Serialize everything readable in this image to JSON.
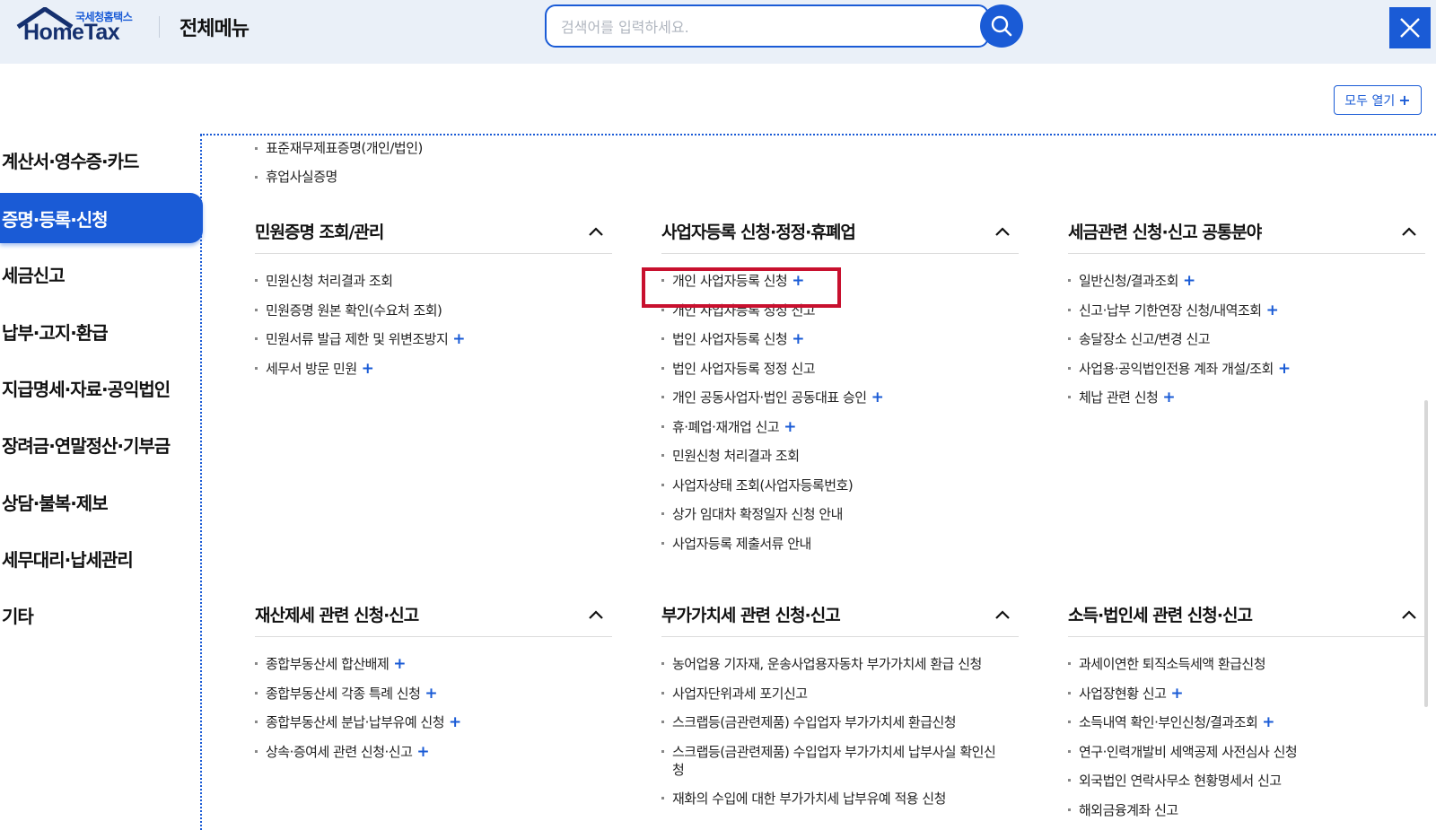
{
  "header": {
    "logo_sub": "국세청홈택스",
    "logo_main": "HomeTax",
    "title": "전체메뉴",
    "search_placeholder": "검색어를 입력하세요.",
    "search_value": ""
  },
  "open_all_label": "모두 열기",
  "open_all_plus": "+",
  "sidebar": {
    "items": [
      {
        "label": "계산서·영수증·카드"
      },
      {
        "label": "증명·등록·신청"
      },
      {
        "label": "세금신고"
      },
      {
        "label": "납부·고지·환급"
      },
      {
        "label": "지급명세·자료·공익법인"
      },
      {
        "label": "장려금·연말정산·기부금"
      },
      {
        "label": "상담·불복·제보"
      },
      {
        "label": "세무대리·납세관리"
      },
      {
        "label": "기타"
      }
    ]
  },
  "stray_items": [
    "표준재무제표증명(개인/법인)",
    "휴업사실증명"
  ],
  "sections": [
    {
      "title": "민원증명 조회/관리",
      "items": [
        {
          "label": "민원신청 처리결과 조회",
          "plus": ""
        },
        {
          "label": "민원증명 원본 확인(수요처 조회)",
          "plus": ""
        },
        {
          "label": "민원서류 발급 제한 및 위변조방지",
          "plus": "+"
        },
        {
          "label": "세무서 방문 민원",
          "plus": "+"
        }
      ]
    },
    {
      "title": "사업자등록 신청·정정·휴폐업",
      "items": [
        {
          "label": "개인 사업자등록 신청",
          "plus": "+"
        },
        {
          "label": "개인 사업자등록 정정 신고",
          "plus": ""
        },
        {
          "label": "법인 사업자등록 신청",
          "plus": "+"
        },
        {
          "label": "법인 사업자등록 정정 신고",
          "plus": ""
        },
        {
          "label": "개인 공동사업자·법인 공동대표 승인",
          "plus": "+"
        },
        {
          "label": "휴·폐업·재개업 신고",
          "plus": "+"
        },
        {
          "label": "민원신청 처리결과 조회",
          "plus": ""
        },
        {
          "label": "사업자상태 조회(사업자등록번호)",
          "plus": ""
        },
        {
          "label": "상가 임대차 확정일자 신청 안내",
          "plus": ""
        },
        {
          "label": "사업자등록 제출서류 안내",
          "plus": ""
        }
      ]
    },
    {
      "title": "세금관련 신청·신고 공통분야",
      "items": [
        {
          "label": "일반신청/결과조회",
          "plus": "+"
        },
        {
          "label": "신고·납부 기한연장 신청/내역조회",
          "plus": "+"
        },
        {
          "label": "송달장소 신고/변경 신고",
          "plus": ""
        },
        {
          "label": "사업용·공익법인전용 계좌 개설/조회",
          "plus": "+"
        },
        {
          "label": "체납 관련 신청",
          "plus": "+"
        }
      ]
    },
    {
      "title": "재산제세 관련 신청·신고",
      "items": [
        {
          "label": "종합부동산세 합산배제",
          "plus": "+"
        },
        {
          "label": "종합부동산세 각종 특례 신청",
          "plus": "+"
        },
        {
          "label": "종합부동산세 분납·납부유예 신청",
          "plus": "+"
        },
        {
          "label": "상속·증여세 관련 신청·신고",
          "plus": "+"
        }
      ]
    },
    {
      "title": "부가가치세 관련 신청·신고",
      "items": [
        {
          "label": "농어업용 기자재, 운송사업용자동차 부가가치세 환급 신청",
          "plus": ""
        },
        {
          "label": "사업자단위과세 포기신고",
          "plus": ""
        },
        {
          "label": "스크랩등(금관련제품) 수입업자 부가가치세 환급신청",
          "plus": ""
        },
        {
          "label": "스크랩등(금관련제품) 수입업자 부가가치세 납부사실 확인신청",
          "plus": ""
        },
        {
          "label": "재화의 수입에 대한 부가가치세 납부유예 적용 신청",
          "plus": ""
        }
      ]
    },
    {
      "title": "소득·법인세 관련 신청·신고",
      "items": [
        {
          "label": "과세이연한 퇴직소득세액 환급신청",
          "plus": ""
        },
        {
          "label": "사업장현황 신고",
          "plus": "+"
        },
        {
          "label": "소득내역 확인·부인신청/결과조회",
          "plus": "+"
        },
        {
          "label": "연구·인력개발비 세액공제 사전심사 신청",
          "plus": ""
        },
        {
          "label": "외국법인 연락사무소 현황명세서 신고",
          "plus": ""
        },
        {
          "label": "해외금융계좌 신고",
          "plus": ""
        }
      ]
    }
  ]
}
